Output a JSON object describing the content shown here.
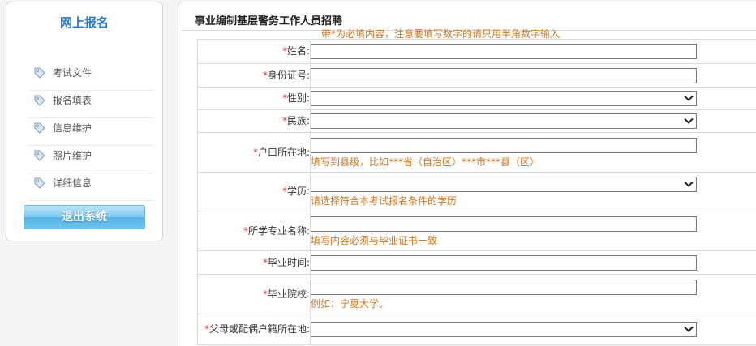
{
  "sidebar": {
    "title": "网上报名",
    "items": [
      {
        "label": "考试文件"
      },
      {
        "label": "报名填表"
      },
      {
        "label": "信息维护"
      },
      {
        "label": "照片维护"
      },
      {
        "label": "详细信息"
      }
    ],
    "logout_label": "退出系统"
  },
  "main": {
    "title": "事业编制基层警务工作人员招聘",
    "notice": "带*为必填内容，注意要填写数字的请只用半角数字输入"
  },
  "form": {
    "required_mark": "*",
    "fields": [
      {
        "label": "姓名:",
        "hint": ""
      },
      {
        "label": "身份证号:",
        "hint": ""
      },
      {
        "label": "性别:",
        "hint": ""
      },
      {
        "label": "民族:",
        "hint": ""
      },
      {
        "label": "户口所在地:",
        "hint": "填写到县级，比如***省（自治区）***市***县（区）"
      },
      {
        "label": "学历:",
        "hint": "请选择符合本考试报名条件的学历"
      },
      {
        "label": "所学专业名称:",
        "hint": "填写内容必须与毕业证书一致"
      },
      {
        "label": "毕业时间:",
        "hint": ""
      },
      {
        "label": "毕业院校:",
        "hint": "例如：宁夏大学。"
      },
      {
        "label": "父母或配偶户籍所在地:",
        "hint": ""
      }
    ]
  },
  "colors": {
    "accent_blue": "#2a78c8",
    "hint_orange": "#d1771f",
    "required_red": "#e03a2b",
    "logout_blue": "#52b3e6"
  }
}
